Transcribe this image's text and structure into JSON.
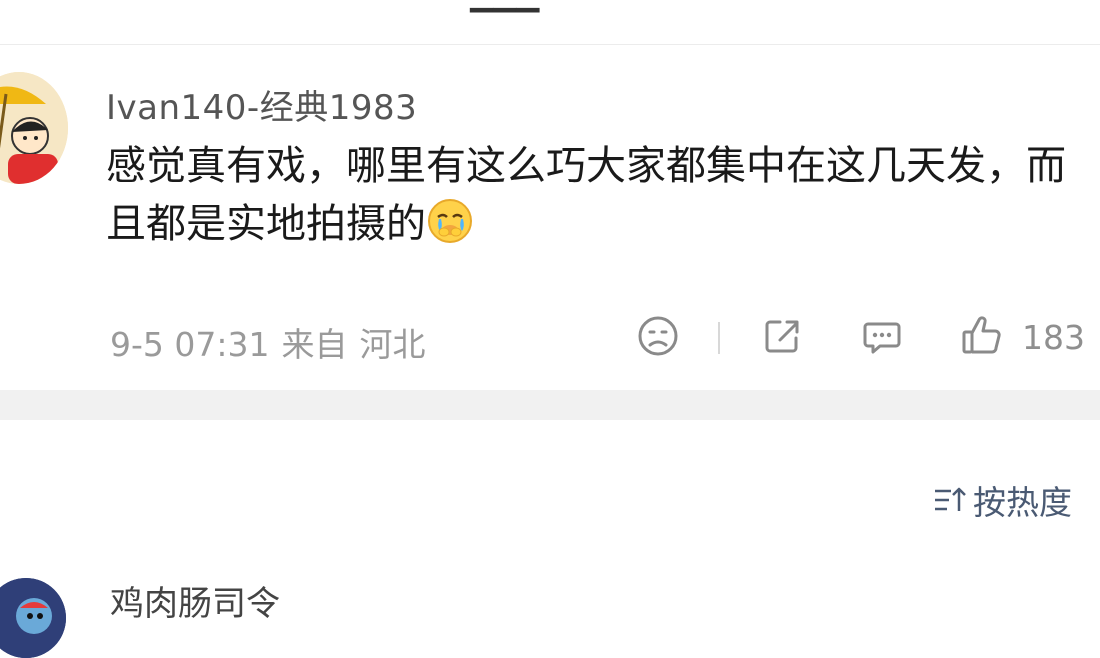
{
  "comment": {
    "username": "Ivan140-经典1983",
    "text": "感觉真有戏，哪里有这么巧大家都集中在这几天发，而且都是实地拍摄的",
    "emoji_icon": "crying-face-emoji",
    "time": "9-5 07:31",
    "from_label": "来自",
    "location": "河北",
    "like_count": "183",
    "icons": [
      "sad-face-icon",
      "share-icon",
      "comment-icon",
      "thumbs-up-icon"
    ]
  },
  "sort": {
    "label": "按热度",
    "icon": "sort-icon",
    "color": "#4a5a73"
  },
  "next_comment": {
    "username": "鸡肉肠司令"
  },
  "colors": {
    "meta_text": "#9a9a9a",
    "separator": "#f1f1f1"
  }
}
